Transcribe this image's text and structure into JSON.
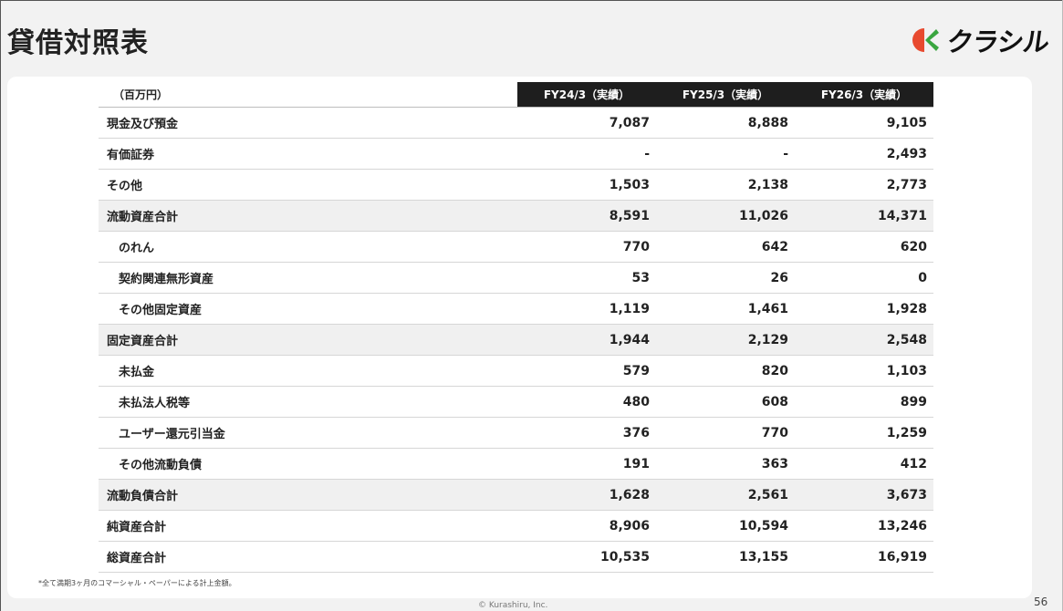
{
  "header": {
    "title": "貸借対照表",
    "logo_text": "クラシル",
    "logo_colors": {
      "red": "#e84a2f",
      "green": "#3aa640"
    }
  },
  "table": {
    "unit_label": "（百万円）",
    "columns": [
      "FY24/3（実績）",
      "FY25/3（実績）",
      "FY26/3（実績）"
    ],
    "rows": [
      {
        "label": "現金及び預金",
        "values": [
          "7,087",
          "8,888",
          "9,105"
        ]
      },
      {
        "label": "有価証券",
        "values": [
          "-",
          "-",
          "2,493"
        ]
      },
      {
        "label": "その他",
        "values": [
          "1,503",
          "2,138",
          "2,773"
        ]
      },
      {
        "label": "流動資産合計",
        "values": [
          "8,591",
          "11,026",
          "14,371"
        ]
      },
      {
        "label": "のれん",
        "values": [
          "770",
          "642",
          "620"
        ]
      },
      {
        "label": "契約関連無形資産",
        "values": [
          "53",
          "26",
          "0"
        ]
      },
      {
        "label": "その他固定資産",
        "values": [
          "1,119",
          "1,461",
          "1,928"
        ]
      },
      {
        "label": "固定資産合計",
        "values": [
          "1,944",
          "2,129",
          "2,548"
        ]
      },
      {
        "label": "未払金",
        "values": [
          "579",
          "820",
          "1,103"
        ]
      },
      {
        "label": "未払法人税等",
        "values": [
          "480",
          "608",
          "899"
        ]
      },
      {
        "label": "ユーザー還元引当金",
        "values": [
          "376",
          "770",
          "1,259"
        ]
      },
      {
        "label": "その他流動負債",
        "values": [
          "191",
          "363",
          "412"
        ]
      },
      {
        "label": "流動負債合計",
        "values": [
          "1,628",
          "2,561",
          "3,673"
        ]
      },
      {
        "label": "純資産合計",
        "values": [
          "8,906",
          "10,594",
          "13,246"
        ]
      },
      {
        "label": "総資産合計",
        "values": [
          "10,535",
          "13,155",
          "16,919"
        ]
      }
    ]
  },
  "footer": {
    "footnote": "*全て満期3ヶ月のコマーシャル・ペーパーによる計上金額。",
    "copyright": "© Kurashiru, Inc.",
    "page_number": "56"
  }
}
